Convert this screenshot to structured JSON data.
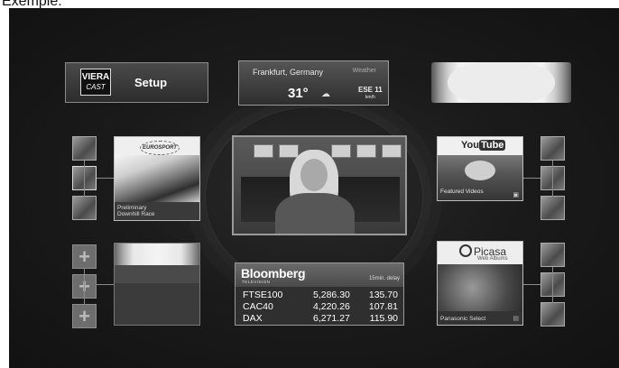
{
  "caption": "Exemple:",
  "setup": {
    "logo_main": "VIERA",
    "logo_sub": "CAST",
    "label": "Setup"
  },
  "weather": {
    "location": "Frankfurt, Germany",
    "tag": "Weather",
    "temperature": "31°",
    "wind_dir": "ESE 11",
    "wind_unit": "km/h",
    "icon": "weather-icon"
  },
  "sport": {
    "logo": "EUROSPORT",
    "caption_line1": "Preliminary",
    "caption_line2": "Downhill Race"
  },
  "youtube": {
    "logo_you": "You",
    "logo_tube": "Tube",
    "caption": "Featured Videos"
  },
  "bloomberg": {
    "logo": "Bloomberg",
    "sub": "TELEVISION",
    "delay": "15min. delay",
    "rows": [
      {
        "name": "FTSE100",
        "value": "5,286.30",
        "change": "135.70"
      },
      {
        "name": "CAC40",
        "value": "4,220.26",
        "change": "107.81"
      },
      {
        "name": "DAX",
        "value": "6,271.27",
        "change": "115.90"
      }
    ]
  },
  "picasa": {
    "logo": "Picasa",
    "sub": "Web Albums",
    "caption": "Panasonic Select"
  },
  "add_symbol": "+"
}
